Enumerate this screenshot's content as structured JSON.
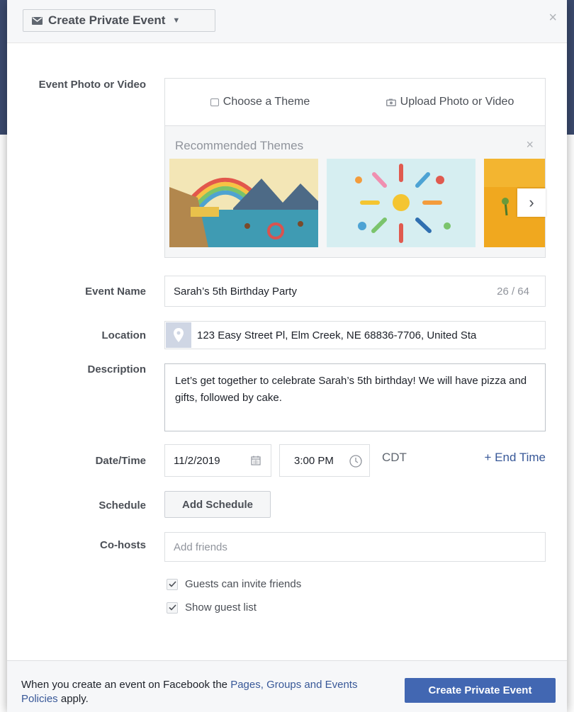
{
  "header": {
    "event_type_label": "Create Private Event",
    "close_glyph": "×"
  },
  "photo": {
    "label": "Event Photo or Video",
    "choose_theme": "Choose a Theme",
    "upload": "Upload Photo or Video",
    "recommended_title": "Recommended Themes",
    "recommended_close": "×",
    "next_glyph": "›"
  },
  "event_name": {
    "label": "Event Name",
    "value": "Sarah’s 5th Birthday Party",
    "counter": "26 / 64"
  },
  "location": {
    "label": "Location",
    "value": "123 Easy Street Pl, Elm Creek, NE 68836-7706, United Sta"
  },
  "description": {
    "label": "Description",
    "value": "Let’s get together to celebrate Sarah’s 5th birthday! We will have pizza and gifts, followed by cake."
  },
  "datetime": {
    "label": "Date/Time",
    "date": "11/2/2019",
    "time": "3:00 PM",
    "timezone": "CDT",
    "end_time": "+ End Time"
  },
  "schedule": {
    "label": "Schedule",
    "button": "Add Schedule"
  },
  "cohosts": {
    "label": "Co-hosts",
    "placeholder": "Add friends"
  },
  "options": [
    {
      "label": "Guests can invite friends",
      "checked": true
    },
    {
      "label": "Show guest list",
      "checked": true
    }
  ],
  "footer": {
    "policy_prefix": "When you create an event on Facebook the ",
    "policy_link": "Pages, Groups and Events Policies",
    "policy_suffix": " apply.",
    "submit": "Create Private Event"
  },
  "colors": {
    "primary": "#4267b2",
    "link": "#385898",
    "backdrop": "#3b4a6e"
  },
  "icons": [
    "envelope-icon",
    "caret-down-icon",
    "close-icon",
    "theme-icon",
    "camera-icon",
    "map-pin-icon",
    "calendar-icon",
    "clock-icon",
    "chevron-right-icon",
    "checkmark-icon"
  ]
}
